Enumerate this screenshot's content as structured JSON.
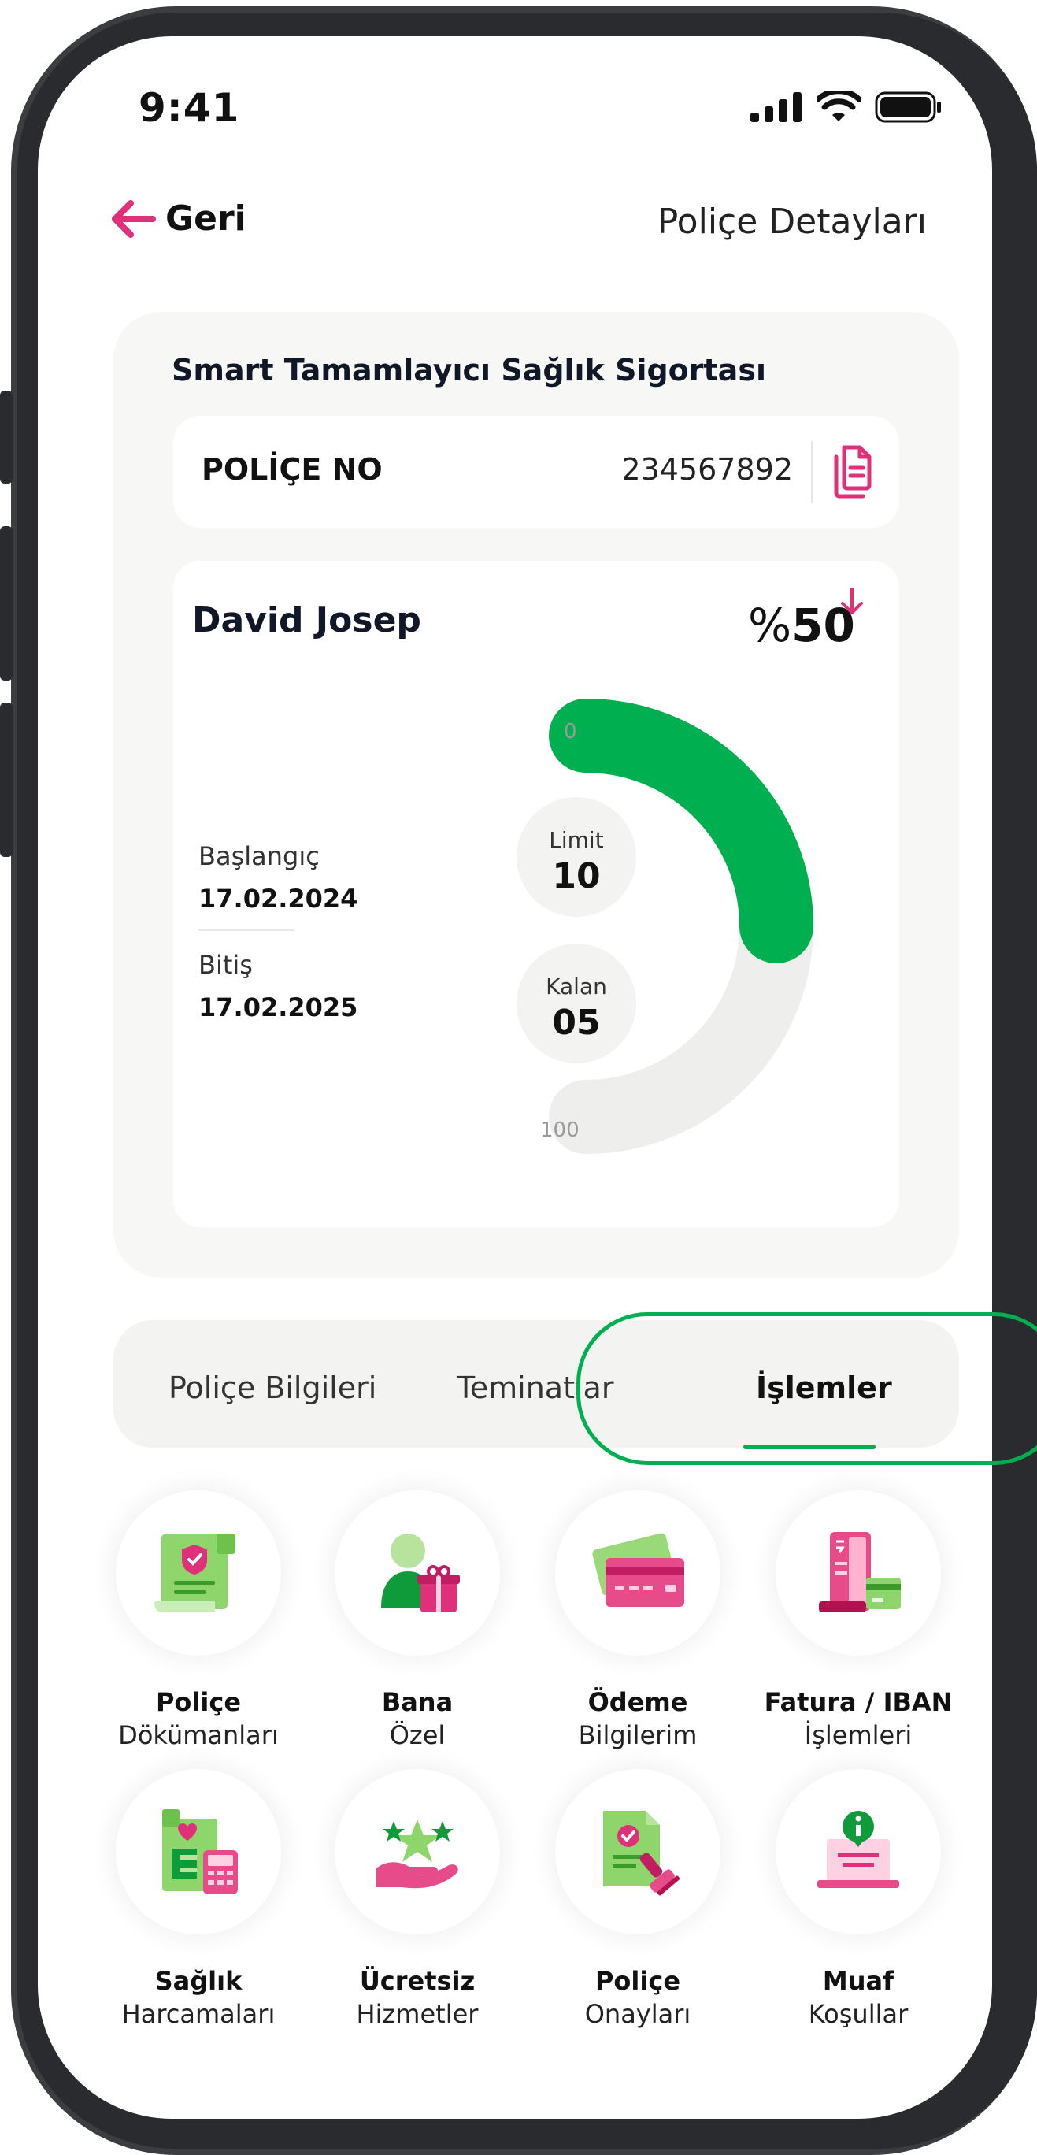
{
  "status_bar": {
    "time": "9:41"
  },
  "header": {
    "back_label": "Geri",
    "title": "Poliçe Detayları"
  },
  "policy": {
    "product_name": "Smart Tamamlayıcı Sağlık Sigortası",
    "number_label": "POLİÇE NO",
    "number_value": "234567892"
  },
  "usage": {
    "user_name": "David Josep",
    "percent_prefix": "%",
    "percent_value": "50",
    "start_label": "Başlangıç",
    "start_date": "17.02.2024",
    "end_label": "Bitiş",
    "end_date": "17.02.2025",
    "limit_label": "Limit",
    "limit_value": "10",
    "remaining_label": "Kalan",
    "remaining_value": "05",
    "gauge_min": "0",
    "gauge_max": "100",
    "gauge_fill_fraction": 0.5,
    "gauge_color": "#00b050",
    "gauge_track_color": "#eeefed"
  },
  "tabs": [
    {
      "label": "Poliçe Bilgileri"
    },
    {
      "label": "Teminatlar"
    },
    {
      "label": "İşlemler",
      "active": true
    }
  ],
  "actions": [
    {
      "title": "Poliçe",
      "subtitle": "Dökümanları",
      "icon": "policy-document-icon"
    },
    {
      "title": "Bana",
      "subtitle": "Özel",
      "icon": "gift-person-icon"
    },
    {
      "title": "Ödeme",
      "subtitle": "Bilgilerim",
      "icon": "credit-card-icon"
    },
    {
      "title": "Fatura / IBAN",
      "subtitle": "İşlemleri",
      "icon": "invoice-icon"
    },
    {
      "title": "Sağlık",
      "subtitle": "Harcamaları",
      "icon": "health-expense-icon"
    },
    {
      "title": "Ücretsiz",
      "subtitle": "Hizmetler",
      "icon": "free-services-icon"
    },
    {
      "title": "Poliçe",
      "subtitle": "Onayları",
      "icon": "policy-approval-icon"
    },
    {
      "title": "Muaf",
      "subtitle": "Koşullar",
      "icon": "exemption-info-icon"
    }
  ],
  "colors": {
    "accent": "#e0307a",
    "success": "#00b050"
  }
}
